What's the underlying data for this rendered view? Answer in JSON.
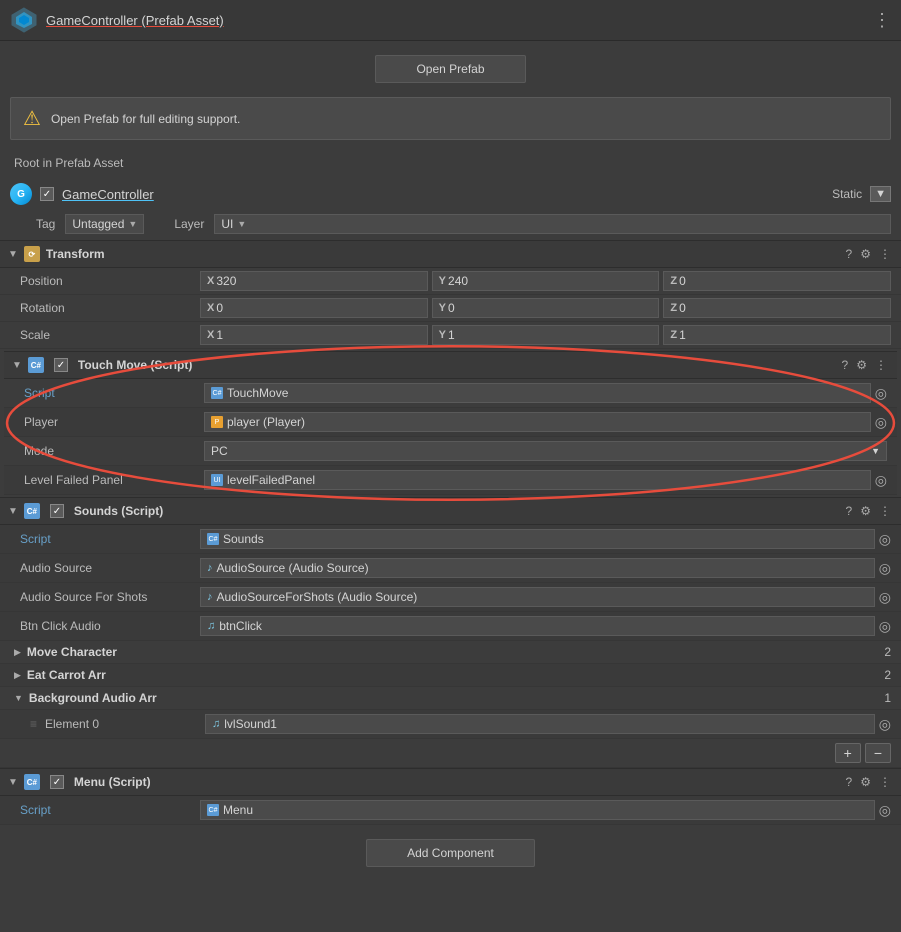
{
  "header": {
    "title": "GameController (Prefab Asset)",
    "dots": "⋮"
  },
  "open_prefab": {
    "label": "Open Prefab"
  },
  "warning": {
    "text": "Open Prefab for full editing support."
  },
  "root_label": "Root in Prefab Asset",
  "object": {
    "name": "GameController",
    "static_label": "Static",
    "tag_label": "Tag",
    "tag_value": "Untagged",
    "layer_label": "Layer",
    "layer_value": "UI"
  },
  "transform": {
    "title": "Transform",
    "position_label": "Position",
    "position": {
      "x": "320",
      "y": "240",
      "z": "0"
    },
    "rotation_label": "Rotation",
    "rotation": {
      "x": "0",
      "y": "0",
      "z": "0"
    },
    "scale_label": "Scale",
    "scale": {
      "x": "1",
      "y": "1",
      "z": "1"
    }
  },
  "touch_move": {
    "title": "Touch Move (Script)",
    "script_label": "Script",
    "script_value": "TouchMove",
    "player_label": "Player",
    "player_value": "player (Player)",
    "mode_label": "Mode",
    "mode_value": "PC",
    "level_failed_label": "Level Failed Panel",
    "level_failed_value": "levelFailedPanel"
  },
  "sounds": {
    "title": "Sounds (Script)",
    "script_label": "Script",
    "script_value": "Sounds",
    "audio_source_label": "Audio Source",
    "audio_source_value": "AudioSource (Audio Source)",
    "audio_source_shots_label": "Audio Source For Shots",
    "audio_source_shots_value": "AudioSourceForShots (Audio Source)",
    "btn_click_label": "Btn Click Audio",
    "btn_click_value": "btnClick",
    "move_char_label": "Move Character",
    "move_char_count": "2",
    "eat_carrot_label": "Eat Carrot Arr",
    "eat_carrot_count": "2",
    "bg_audio_label": "Background Audio Arr",
    "bg_audio_count": "1",
    "element0_label": "Element 0",
    "element0_value": "lvlSound1",
    "add_label": "+",
    "remove_label": "−"
  },
  "menu": {
    "title": "Menu (Script)",
    "script_label": "Script",
    "script_value": "Menu"
  },
  "add_component": {
    "label": "Add Component"
  },
  "icons": {
    "help": "?",
    "settings": "☰",
    "dots": "⋮",
    "circle": "○"
  }
}
